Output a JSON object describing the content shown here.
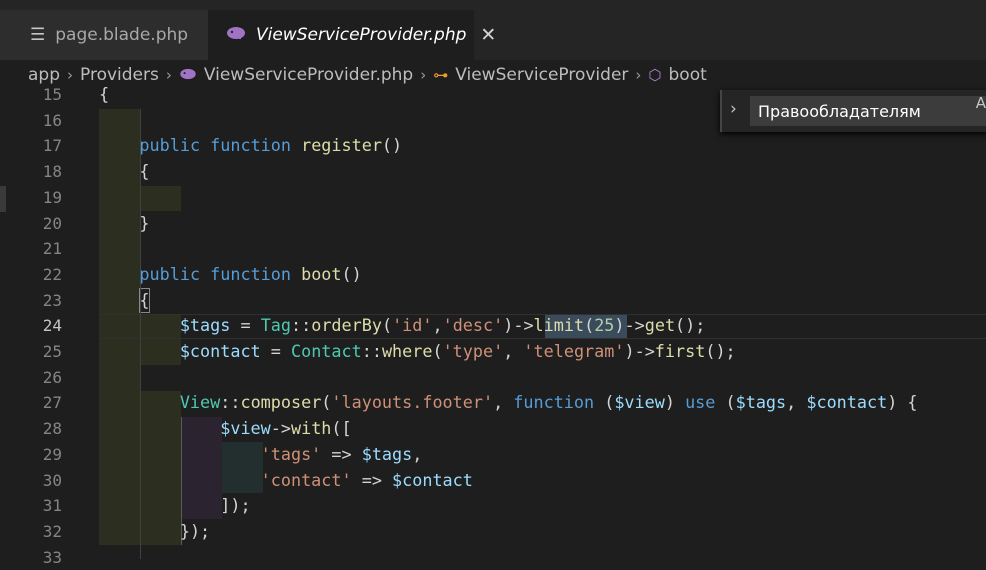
{
  "tabs": [
    {
      "icon": "text-file-icon",
      "label": "page.blade.php",
      "active": false
    },
    {
      "icon": "php-elephant-icon",
      "label": "ViewServiceProvider.php",
      "active": true,
      "close": "✕"
    }
  ],
  "breadcrumb": {
    "items": [
      "app",
      "Providers",
      "ViewServiceProvider.php",
      "ViewServiceProvider",
      "boot"
    ],
    "separator": "›"
  },
  "find_widget": {
    "value": "Правообладателям",
    "toggle": "›",
    "match_case": "A"
  },
  "editor": {
    "active_line": 24,
    "lines": [
      {
        "no": "15",
        "code": "{"
      },
      {
        "no": "16",
        "code": ""
      },
      {
        "no": "17",
        "code": "    public function register()"
      },
      {
        "no": "18",
        "code": "    {"
      },
      {
        "no": "19",
        "code": ""
      },
      {
        "no": "20",
        "code": "    }"
      },
      {
        "no": "21",
        "code": ""
      },
      {
        "no": "22",
        "code": "    public function boot()"
      },
      {
        "no": "23",
        "code": "    {"
      },
      {
        "no": "24",
        "code": "        $tags = Tag::orderBy('id','desc')->limit(25)->get();"
      },
      {
        "no": "25",
        "code": "        $contact = Contact::where('type', 'telegram')->first();"
      },
      {
        "no": "26",
        "code": ""
      },
      {
        "no": "27",
        "code": "        View::composer('layouts.footer', function ($view) use ($tags, $contact) {"
      },
      {
        "no": "28",
        "code": "            $view->with(["
      },
      {
        "no": "29",
        "code": "                'tags' => $tags,"
      },
      {
        "no": "30",
        "code": "                'contact' => $contact"
      },
      {
        "no": "31",
        "code": "            ]);"
      },
      {
        "no": "32",
        "code": "        });"
      },
      {
        "no": "33",
        "code": ""
      }
    ]
  },
  "colors": {
    "background": "#1e1e1e",
    "keyword": "#569cd6",
    "function": "#dcdcaa",
    "variable": "#9cdcfe",
    "class": "#4ec9b0",
    "string": "#ce9178",
    "number": "#b5cea8",
    "indent_highlight": "#2c2e20",
    "indent_highlight_inner": "#2b2430"
  }
}
